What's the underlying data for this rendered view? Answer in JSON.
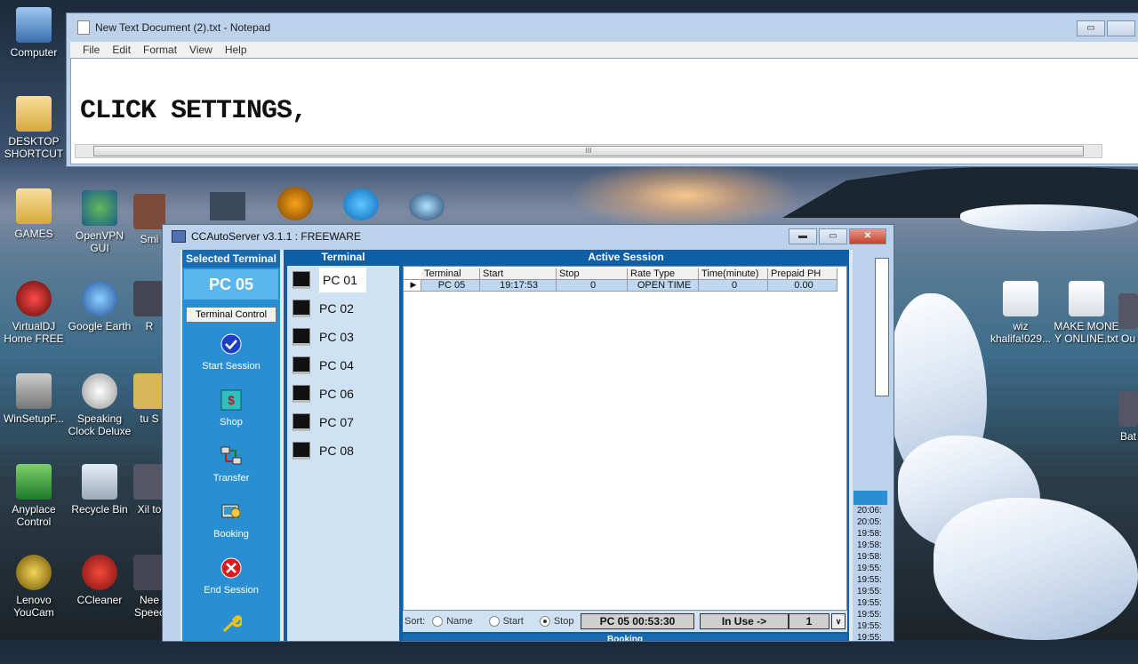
{
  "desktop": {
    "icons_left": [
      {
        "label": "Computer"
      },
      {
        "label": "DESKTOP SHORTCUT"
      },
      {
        "label": "GAMES"
      },
      {
        "label": "OpenVPN GUI"
      },
      {
        "label": "Smi"
      },
      {
        "label": "VirtualDJ Home FREE"
      },
      {
        "label": "Google Earth"
      },
      {
        "label": "R"
      },
      {
        "label": "WinSetupF..."
      },
      {
        "label": "Speaking Clock Deluxe"
      },
      {
        "label": "tu S"
      },
      {
        "label": "Anyplace Control"
      },
      {
        "label": "Recycle Bin"
      },
      {
        "label": "Xil to"
      },
      {
        "label": "Lenovo YouCam"
      },
      {
        "label": "CCleaner"
      },
      {
        "label": "Nee Speec"
      }
    ],
    "icons_right": [
      {
        "label": "wiz khalifa!029..."
      },
      {
        "label": "MAKE MONE Y ONLINE.txt"
      },
      {
        "label": "Ou"
      },
      {
        "label": "Bat"
      }
    ]
  },
  "notepad": {
    "title": "New Text Document (2).txt - Notepad",
    "menu": [
      "File",
      "Edit",
      "Format",
      "View",
      "Help"
    ],
    "content": "CLICK SETTINGS,",
    "scroll_grip": "III"
  },
  "ccauto": {
    "title": "CCAutoServer v3.1.1 : FREEWARE",
    "selected_terminal_header": "Selected Terminal",
    "selected_terminal": "PC 05",
    "terminal_control": "Terminal Control",
    "tools": [
      {
        "label": "Start Session",
        "icon": "check-icon"
      },
      {
        "label": "Shop",
        "icon": "dollar-icon"
      },
      {
        "label": "Transfer",
        "icon": "transfer-icon"
      },
      {
        "label": "Booking",
        "icon": "booking-icon"
      },
      {
        "label": "End Session",
        "icon": "end-icon"
      }
    ],
    "terminal_header": "Terminal",
    "terminals": [
      "PC 01",
      "PC 02",
      "PC 03",
      "PC 04",
      "PC 06",
      "PC 07",
      "PC 08"
    ],
    "active_session_header": "Active Session",
    "grid_columns": [
      "Terminal",
      "Start",
      "Stop",
      "Rate Type",
      "Time(minute)",
      "Prepaid PH"
    ],
    "grid_rows": [
      {
        "terminal": "PC 05",
        "start": "19:17:53",
        "stop": "0",
        "rate_type": "OPEN TIME",
        "time": "0",
        "prepaid": "0.00"
      }
    ],
    "sort_label": "Sort:",
    "sort_options": [
      "Name",
      "Start",
      "Stop"
    ],
    "sort_selected": "Stop",
    "status_session": "PC 05  00:53:30",
    "status_inuse": "In Use ->",
    "status_count": "1",
    "booking_label": "Booking",
    "log_times": [
      "20:06:",
      "20:05:",
      "19:58:",
      "19:58:",
      "19:58:",
      "19:55:",
      "19:55:",
      "19:55:",
      "19:55:",
      "19:55:",
      "19:55:",
      "19:55:"
    ]
  }
}
